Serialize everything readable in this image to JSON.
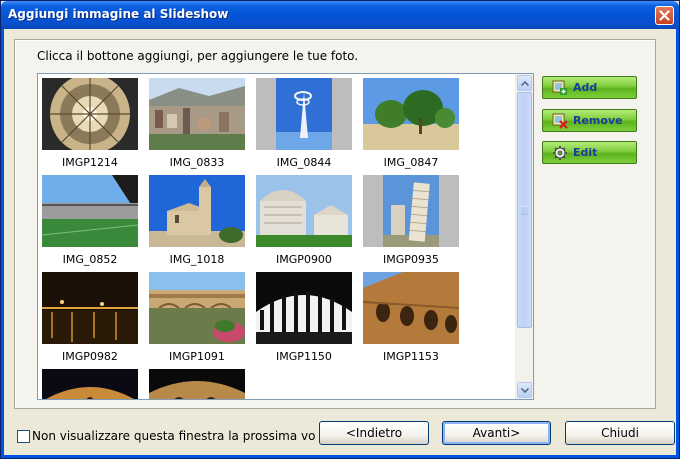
{
  "window": {
    "title": "Aggiungi immagine al Slideshow"
  },
  "instruction": "Clicca il bottone aggiungi, per aggiungere le tue foto.",
  "photos": [
    {
      "name": "IMGP1214",
      "scene": "dome-interior"
    },
    {
      "name": "IMG_0833",
      "scene": "city-view"
    },
    {
      "name": "IMG_0844",
      "scene": "tower-sky"
    },
    {
      "name": "IMG_0847",
      "scene": "garden-trees"
    },
    {
      "name": "IMG_0852",
      "scene": "stadium"
    },
    {
      "name": "IMG_1018",
      "scene": "church-sky"
    },
    {
      "name": "IMGP0900",
      "scene": "cathedral-pisa"
    },
    {
      "name": "IMGP0935",
      "scene": "leaning-tower"
    },
    {
      "name": "IMGP0982",
      "scene": "night-river"
    },
    {
      "name": "IMG P1091",
      "scene": "bridge-river"
    },
    {
      "name": "IMGP1150",
      "scene": "colosseum-inside"
    },
    {
      "name": "IMGP1153",
      "scene": "colosseum-wall"
    },
    {
      "name": "",
      "scene": "colosseum-night"
    },
    {
      "name": "",
      "scene": "colosseum-arch"
    }
  ],
  "actions": {
    "add": "Add",
    "remove": "Remove",
    "edit": "Edit"
  },
  "footer": {
    "checkbox_label": "Non visualizzare questa finestra la prossima vo",
    "back": "<Indietro",
    "next": "Avanti>",
    "close": "Chiudi"
  }
}
